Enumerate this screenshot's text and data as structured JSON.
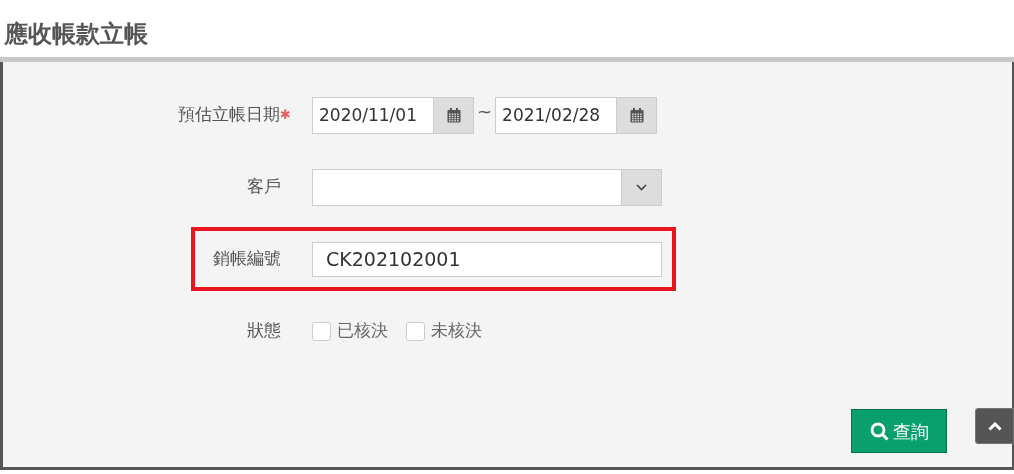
{
  "page_title": "應收帳款立帳",
  "fields": [
    {
      "kind": "date_range",
      "label": "預估立帳日期",
      "required_mark": "✱",
      "highlighted": false,
      "from": "2020/11/01",
      "separator": "~",
      "to": "2021/02/28"
    },
    {
      "kind": "select",
      "label": "客戶",
      "highlighted": false
    },
    {
      "kind": "text",
      "label": "銷帳編號",
      "highlighted": true,
      "value": "CK202102001"
    },
    {
      "kind": "checkboxes",
      "label": "狀態",
      "highlighted": false,
      "options": [
        {
          "label": "已核決",
          "checked": false
        },
        {
          "label": "未核決",
          "checked": false
        }
      ]
    }
  ],
  "search_button": "查詢"
}
